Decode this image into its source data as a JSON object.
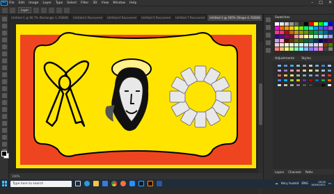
{
  "menubar": {
    "logo": "Ps",
    "items": [
      "File",
      "Edit",
      "Image",
      "Layer",
      "Type",
      "Select",
      "Filter",
      "3D",
      "View",
      "Window",
      "Help"
    ],
    "controls": [
      "–",
      "□",
      "✕"
    ]
  },
  "options": {
    "chip_label": "Layer"
  },
  "tabs": [
    {
      "label": "Untitled-1 @ 66.7% (Rectangle 1, RGB/8)",
      "active": false
    },
    {
      "label": "Untitled-2 Recovered",
      "active": false
    },
    {
      "label": "Untitled-4 Recovered",
      "active": false
    },
    {
      "label": "Untitled-5 Recovered",
      "active": false
    },
    {
      "label": "Untitled-7 Recovered",
      "active": false
    },
    {
      "label": "Untitled-3 @ 200% (Shape 4, RGB/8)",
      "active": true
    }
  ],
  "status": {
    "zoom": "100%"
  },
  "panels": {
    "swatches_title": "Swatches",
    "adjustments_tab": "Adjustments",
    "styles_tab": "Styles",
    "layers_tab": "Layers",
    "channels_tab": "Channels",
    "paths_tab": "Paths"
  },
  "colors": {
    "canvas_yellow": "#ffe400",
    "canvas_orange": "#ee4520",
    "halo_yellow": "#fff08a",
    "petal": "#e8e8e8"
  },
  "swatch_colors": [
    "#ffffff",
    "#e6e6e6",
    "#cccccc",
    "#999999",
    "#666666",
    "#333333",
    "#000000",
    "#ff0000",
    "#ffff00",
    "#00ff00",
    "#00ffff",
    "#0000ff",
    "#ff00ff",
    "#ff6600",
    "#ff9900",
    "#ffcc00",
    "#ccff00",
    "#66ff00",
    "#00ff66",
    "#00ffcc",
    "#0099ff",
    "#3366ff",
    "#6633ff",
    "#cc33ff",
    "#ff3399",
    "#ff3366",
    "#cc0000",
    "#cc6600",
    "#cc9900",
    "#999900",
    "#669900",
    "#009900",
    "#009966",
    "#009999",
    "#006699",
    "#003399",
    "#330099",
    "#660099",
    "#990066",
    "#990033",
    "#ff9999",
    "#ffcc99",
    "#ffff99",
    "#ccff99",
    "#99ffcc",
    "#99ffff",
    "#99ccff",
    "#9999ff",
    "#cc99ff",
    "#ff99cc",
    "#660000",
    "#663300",
    "#666600",
    "#336600",
    "#006633",
    "#006666",
    "#003366",
    "#000066",
    "#330066",
    "#660033",
    "#ffcccc",
    "#ffe5cc",
    "#ffffcc",
    "#e5ffcc",
    "#ccffe5",
    "#ccffff",
    "#cce5ff",
    "#ccccff",
    "#e5ccff",
    "#ffcce5",
    "#804000",
    "#408000",
    "#ff8080",
    "#ffbf80",
    "#ffff80",
    "#bfff80",
    "#80ffbf",
    "#80ffff",
    "#80bfff",
    "#8080ff",
    "#bf80ff",
    "#ff80bf",
    "#404040",
    "#808080"
  ],
  "style_colors": [
    "#7ab8f5",
    "#5b8fd6",
    "#4da3e8",
    "#76c7c0",
    "#a0a0a0",
    "#c8c8c8",
    "#6fa8dc",
    "#3d85c6",
    "#9fc5e8",
    "#b4a7d6",
    "#8e7cc3",
    "#d5a6bd",
    "#ea9999",
    "#f9cb9c",
    "#ffe599",
    "#b6d7a8",
    "#a2c4c9",
    "#6d9eeb",
    "#e06666",
    "#f6b26b",
    "#ffd966",
    "#93c47d",
    "#76a5af",
    "#6fa8dc",
    "#8e7cc3",
    "#c27ba0",
    "#cc4125",
    "#4a86e8",
    "#00b0f0",
    "#92d050",
    "#ffc000",
    "#7030a0",
    "#c00000",
    "#0070c0",
    "#00b050",
    "#ff6600",
    "#d9d9d9",
    "#bfbfbf",
    "#a6a6a6",
    "#7f7f7f",
    "#595959",
    "#3f3f3f",
    "#262626",
    "#0d0d0d",
    "#f2f2f2"
  ],
  "taskbar": {
    "search_placeholder": "Type here to search",
    "weather": "Very humid",
    "lang": "ENG",
    "time": "09:26",
    "date": "16/09/2021"
  }
}
